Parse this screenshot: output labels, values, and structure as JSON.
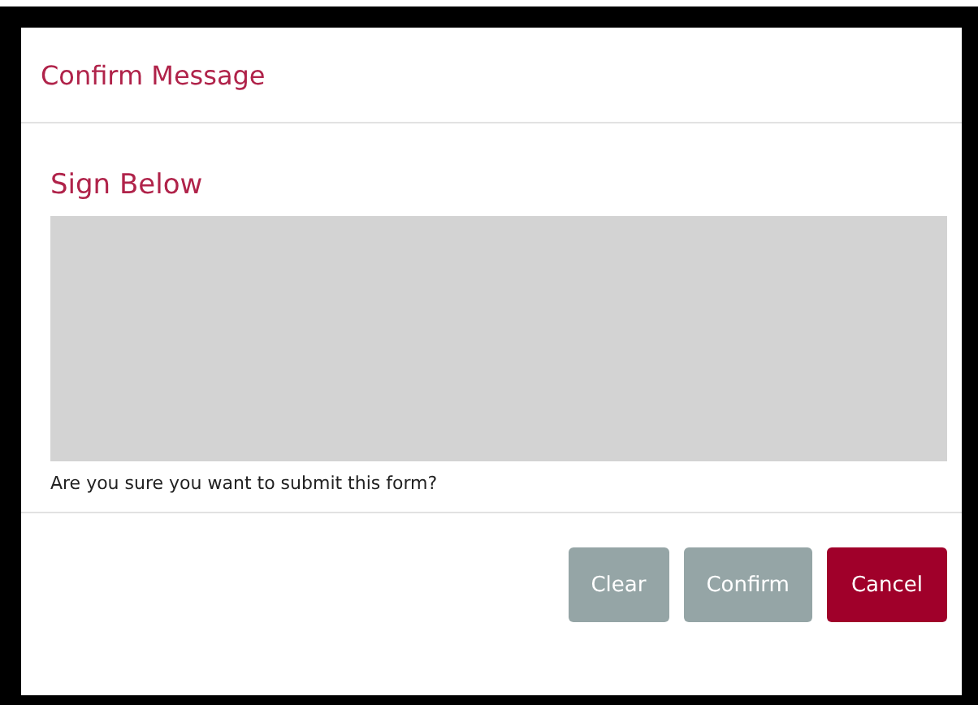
{
  "dialog": {
    "title": "Confirm Message",
    "signature_label": "Sign Below",
    "message": "Are you sure you want to submit this form?"
  },
  "buttons": [
    {
      "label": "Clear",
      "kind": "secondary"
    },
    {
      "label": "Confirm",
      "kind": "secondary"
    },
    {
      "label": "Cancel",
      "kind": "danger"
    }
  ]
}
